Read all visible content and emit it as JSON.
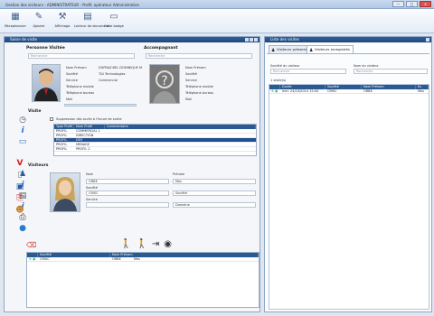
{
  "window": {
    "title": "Gestion des visiteurs - ADMINISTRATEUR - Profil: opérateur Administration",
    "min": "—",
    "max": "□",
    "close": "✕"
  },
  "ribbon": [
    {
      "label": "Réceptionner",
      "icon": "▦"
    },
    {
      "label": "Ajouter",
      "icon": "✎"
    },
    {
      "label": "Affichage",
      "icon": "⚒"
    },
    {
      "label": "Lecteur de document",
      "icon": "▤"
    },
    {
      "label": "Code badge",
      "icon": "▭"
    }
  ],
  "left_panel": {
    "title": "Saisie de visite",
    "personne_title": "Personne Visitée",
    "accompagnant_title": "Accompagnant",
    "search_placeholder": "Recherche",
    "host": {
      "labels": [
        "Nom Prénom",
        "Société",
        "Service",
        "Téléphone mobile",
        "Téléphone bureau",
        "Mail"
      ],
      "values": [
        "DUPRAZ-BEL DOMINIQUE M",
        "T&I Technologies",
        "Commercial",
        "",
        "",
        ""
      ]
    },
    "accomp_labels": [
      "Nom Prénom",
      "Société",
      "Service",
      "Téléphone mobile",
      "Téléphone bureau",
      "Mail"
    ],
    "visite_title": "Visite",
    "checkbox_label": "Suppression des accès à l'heure de sortie",
    "profile_columns": [
      "Type Profil",
      "Nom Profil",
      "Commentaire"
    ],
    "profiles": [
      {
        "type": "PROFIL",
        "name": "COMMERCIAL 1",
        "comment": "",
        "selected": false
      },
      {
        "type": "PROFIL",
        "name": "DIRECTION",
        "comment": "",
        "selected": false
      },
      {
        "type": "PROFIL",
        "name": "DEV",
        "comment": "",
        "selected": true
      },
      {
        "type": "PROFIL",
        "name": "MENAGE",
        "comment": "",
        "selected": false
      },
      {
        "type": "PROFIL",
        "name": "PROFIL 2",
        "comment": "",
        "selected": false
      }
    ],
    "visiteurs_title": "Visiteurs",
    "visitor_labels": [
      "Nom",
      "Société",
      "Service"
    ],
    "visitor_values": [
      "ORBE",
      "CRISC",
      ""
    ],
    "visitor_labels2": [
      "Prénom",
      "",
      ""
    ],
    "visitor_values2": [
      "Mes",
      "Société",
      "Domaine"
    ],
    "list_columns": [
      "",
      "Société",
      "Nom Prénom"
    ],
    "list_rows": [
      {
        "icons": "⊕ ▣",
        "company": "CRISC",
        "name": "ORBE",
        "first": "Mes"
      }
    ]
  },
  "right_panel": {
    "title": "Liste des visites",
    "tabs": [
      "Visiteurs présents",
      "Visiteurs enregistrés"
    ],
    "societe_label": "Société du visiteur",
    "nom_label": "Nom du visiteur",
    "search_placeholder": "Recherche",
    "group_label": "1 visite(s)",
    "columns": [
      "",
      "Durée",
      "Société",
      "Nom Prénom",
      "Es"
    ],
    "rows": [
      {
        "icons": "⊕ ▣",
        "date": "mer. 24/10/2014 15:04",
        "company": "CRISC",
        "name": "ORBE",
        "extra": "Mes"
      }
    ]
  }
}
